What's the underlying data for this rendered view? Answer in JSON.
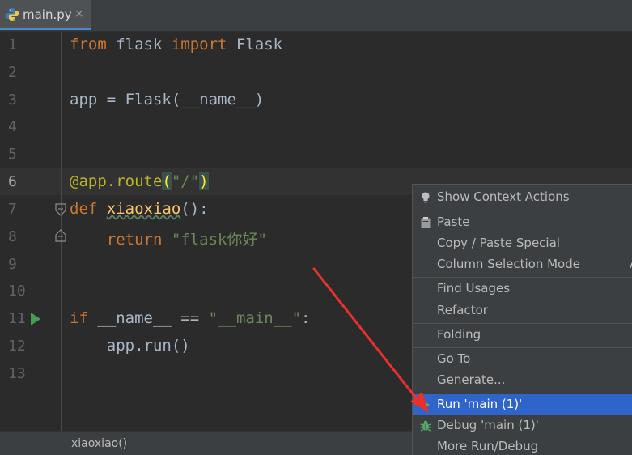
{
  "tab": {
    "filename": "main.py",
    "close_glyph": "×",
    "icon": "python-file-icon"
  },
  "editor": {
    "lines": [
      {
        "num": "1"
      },
      {
        "num": "2"
      },
      {
        "num": "3"
      },
      {
        "num": "4"
      },
      {
        "num": "5"
      },
      {
        "num": "6"
      },
      {
        "num": "7"
      },
      {
        "num": "8"
      },
      {
        "num": "9"
      },
      {
        "num": "10"
      },
      {
        "num": "11"
      },
      {
        "num": "12"
      },
      {
        "num": "13"
      }
    ],
    "code": {
      "l1_from": "from",
      "l1_flask": " flask ",
      "l1_import": "import",
      "l1_Flask": " Flask",
      "l3_app": "app = Flask(",
      "l3_name": "__name__",
      "l3_close": ")",
      "l6_dec": "@app.route",
      "l6_open": "(",
      "l6_str": "\"/\"",
      "l6_close": ")",
      "l7_def": "def",
      "l7_sp": " ",
      "l7_fn": "xiaoxiao",
      "l7_rest": "():",
      "l8_indent": "    ",
      "l8_return": "return",
      "l8_sp": " ",
      "l8_str": "\"flask你好\"",
      "l11_if": "if",
      "l11_sp": " ",
      "l11_name": "__name__",
      "l11_eq": " == ",
      "l11_str": "\"__main__\"",
      "l11_colon": ":",
      "l12": "    app.run()"
    }
  },
  "status": {
    "breadcrumb": "xiaoxiao()"
  },
  "context_menu": {
    "items": [
      {
        "label": "Show Context Actions",
        "icon": "lightbulb-icon"
      },
      {
        "label": "Paste",
        "icon": "clipboard-icon"
      },
      {
        "label": "Copy / Paste Special"
      },
      {
        "label": "Column Selection Mode"
      },
      {
        "label": "Find Usages"
      },
      {
        "label": "Refactor"
      },
      {
        "label": "Folding"
      },
      {
        "label": "Go To"
      },
      {
        "label": "Generate..."
      },
      {
        "label": "Run 'main (1)'",
        "icon": "run-icon",
        "selected": true
      },
      {
        "label": "Debug 'main (1)'",
        "icon": "debug-bug-icon"
      },
      {
        "label": "More Run/Debug"
      }
    ],
    "truncated_shortcut": "A"
  },
  "colors": {
    "background": "#2b2b2b",
    "keyword": "#cc7832",
    "string": "#6a8759",
    "decorator": "#bbb529",
    "function": "#ffc66d",
    "selection": "#2f65ca",
    "annotation_arrow": "#e8312a"
  }
}
